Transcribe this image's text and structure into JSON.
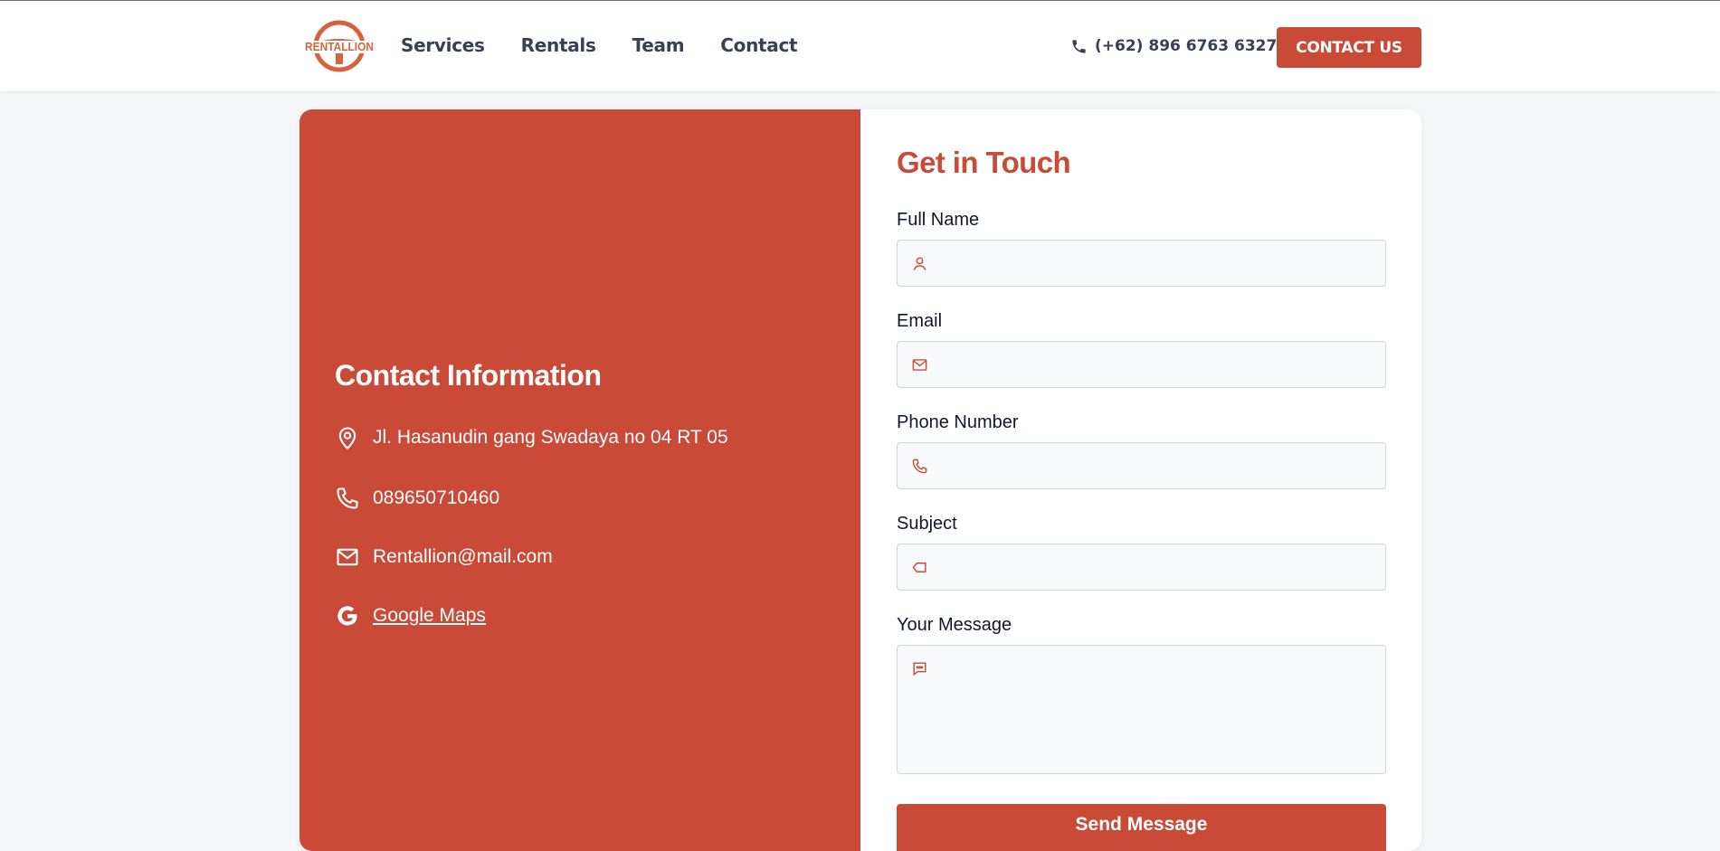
{
  "brand": {
    "logo_text": "RENTALLION",
    "accent": "#c84a37"
  },
  "nav": {
    "items": [
      "Services",
      "Rentals",
      "Team",
      "Contact"
    ]
  },
  "header": {
    "phone": "(+62) 896 6763 6327",
    "cta_label": "CONTACT US"
  },
  "contact_info": {
    "title": "Contact Information",
    "address": "Jl. Hasanudin gang Swadaya no 04 RT 05",
    "phone": "089650710460",
    "email": "Rentallion@mail.com",
    "maps_label": "Google Maps"
  },
  "form": {
    "title": "Get in Touch",
    "full_name_label": "Full Name",
    "email_label": "Email",
    "phone_label": "Phone Number",
    "subject_label": "Subject",
    "message_label": "Your Message",
    "full_name_value": "",
    "email_value": "",
    "phone_value": "",
    "subject_value": "",
    "message_value": "",
    "submit_label": "Send Message"
  }
}
